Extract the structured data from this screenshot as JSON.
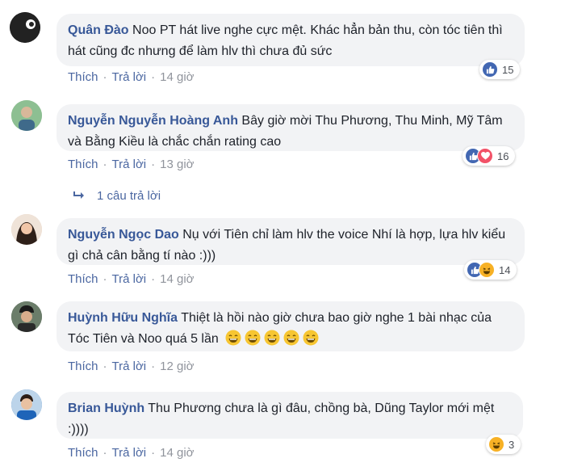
{
  "comments": [
    {
      "name": "Quân Đào",
      "text": "Noo PT hát live nghe cực mệt. Khác hẳn bản thu, còn tóc tiên thì hát cũng đc nhưng để làm hlv thì chưa đủ sức",
      "like": "Thích",
      "reply": "Trả lời",
      "time": "14 giờ",
      "reactions": [
        "like"
      ],
      "count": "15"
    },
    {
      "name": "Nguyễn Nguyễn Hoàng Anh",
      "text": "Bây giờ mời Thu Phương, Thu Minh, Mỹ Tâm và Bằng Kiều là chắc chắn rating cao",
      "like": "Thích",
      "reply": "Trả lời",
      "time": "13 giờ",
      "reactions": [
        "like",
        "love"
      ],
      "count": "16"
    },
    {
      "name": "Nguyễn Ngọc Dao",
      "text": "Nụ với Tiên chỉ làm hlv the voice Nhí là hợp, lựa hlv kiểu gì chả cân bằng tí nào :)))",
      "like": "Thích",
      "reply": "Trả lời",
      "time": "14 giờ",
      "reactions": [
        "like",
        "haha"
      ],
      "count": "14"
    },
    {
      "name": "Huỳnh Hữu Nghĩa",
      "text": "Thiệt là hồi nào giờ chưa bao giờ nghe 1 bài nhạc của Tóc Tiên và Noo quá 5 lần",
      "emoji_count": 5,
      "like": "Thích",
      "reply": "Trả lời",
      "time": "12 giờ"
    },
    {
      "name": "Brian Huỳnh",
      "text": "Thu Phương chưa là gì đâu, chồng bà, Dũng Taylor mới mệt :))))",
      "like": "Thích",
      "reply": "Trả lời",
      "time": "14 giờ",
      "reactions": [
        "haha"
      ],
      "count": "3"
    }
  ],
  "replies_link": "1 câu trả lời",
  "colors": {
    "name": "#385898",
    "bubble": "#f2f3f5",
    "link": "#4b67a1",
    "meta": "#90949c",
    "like": "#4267b2",
    "love": "#f25268",
    "haha": "#f7b125"
  }
}
